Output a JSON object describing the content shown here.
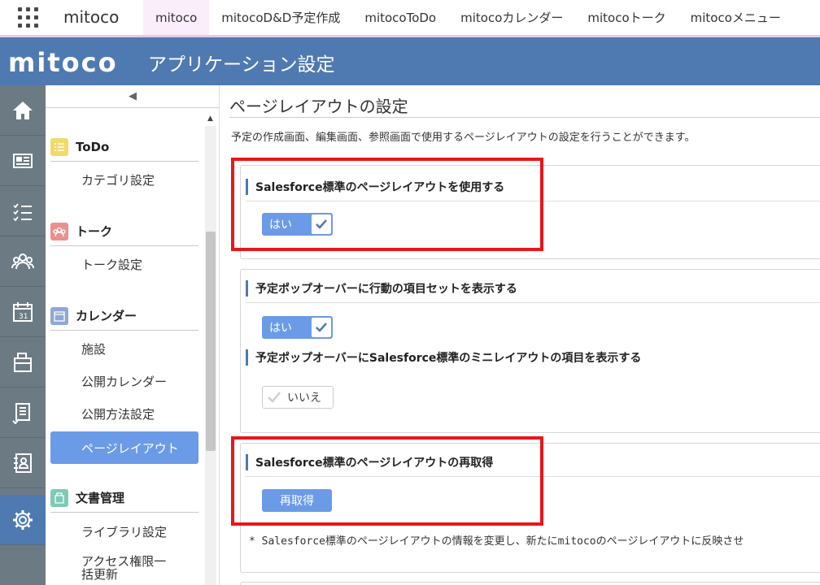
{
  "topnav": {
    "app_name": "mitoco",
    "tabs": [
      {
        "label": "mitoco"
      },
      {
        "label": "mitocoD&D予定作成"
      },
      {
        "label": "mitocoToDo"
      },
      {
        "label": "mitocoカレンダー"
      },
      {
        "label": "mitocoトーク"
      },
      {
        "label": "mitocoメニュー"
      }
    ]
  },
  "header": {
    "logo": "mitoco",
    "title": "アプリケーション設定"
  },
  "rail": {
    "icons": [
      "home-icon",
      "newspaper-icon",
      "checklist-icon",
      "people-icon",
      "calendar-icon",
      "documents-icon",
      "report-icon",
      "address-book-icon",
      "gear-icon"
    ]
  },
  "sidebar": {
    "collapse_glyph": "◀",
    "sections": [
      {
        "name": "ToDo",
        "icon": "todo-icon",
        "color": "#f3d96a",
        "items": [
          "カテゴリ設定"
        ]
      },
      {
        "name": "トーク",
        "icon": "talk-icon",
        "color": "#ec8f8f",
        "items": [
          "トーク設定"
        ]
      },
      {
        "name": "カレンダー",
        "icon": "calendar-icon",
        "color": "#8fa7d9",
        "items": [
          "施設",
          "公開カレンダー",
          "公開方法設定",
          "ページレイアウト"
        ]
      },
      {
        "name": "文書管理",
        "icon": "document-icon",
        "color": "#7fc9b8",
        "items": [
          "ライブラリ設定",
          "アクセス権限一括更新"
        ]
      }
    ]
  },
  "main": {
    "title": "ページレイアウトの設定",
    "description": "予定の作成画面、編集画面、参照画面で使用するページレイアウトの設定を行うことができます。",
    "card1": {
      "heading": "Salesforce標準のページレイアウトを使用する",
      "toggle_label": "はい"
    },
    "card2": {
      "heading1": "予定ポップオーバーに行動の項目セットを表示する",
      "toggle1_label": "はい",
      "heading2": "予定ポップオーバーにSalesforce標準のミニレイアウトの項目を表示する",
      "toggle2_label": "いいえ"
    },
    "card3": {
      "heading": "Salesforce標準のページレイアウトの再取得",
      "button_label": "再取得",
      "note": "* Salesforce標準のページレイアウトの情報を変更し、新たにmitocoのページレイアウトに反映させ"
    }
  },
  "colors": {
    "header": "#4f7ab1",
    "accent": "#6b9be6",
    "highlight": "#e8161a",
    "rail": "#6c7a84"
  }
}
